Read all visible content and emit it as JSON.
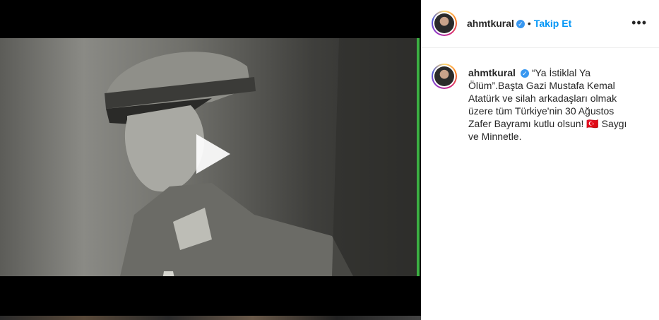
{
  "post": {
    "username": "ahmtkural",
    "separator": "•",
    "follow_label": "Takip Et",
    "more_label": "•••",
    "caption": "“Ya İstiklal Ya Ölüm”.Başta Gazi Mustafa Kemal Atatürk ve silah arkadaşları olmak üzere tüm Türkiye'nin 30 Ağustos Zafer Bayramı kutlu olsun! 🇹🇷 Saygı ve Minnetle."
  },
  "icons": {
    "verified": "verified-badge-icon",
    "play": "play-icon",
    "more": "more-options-icon"
  },
  "colors": {
    "accent": "#0095f6",
    "verified": "#3897f0",
    "green_edge": "#3cb043"
  }
}
